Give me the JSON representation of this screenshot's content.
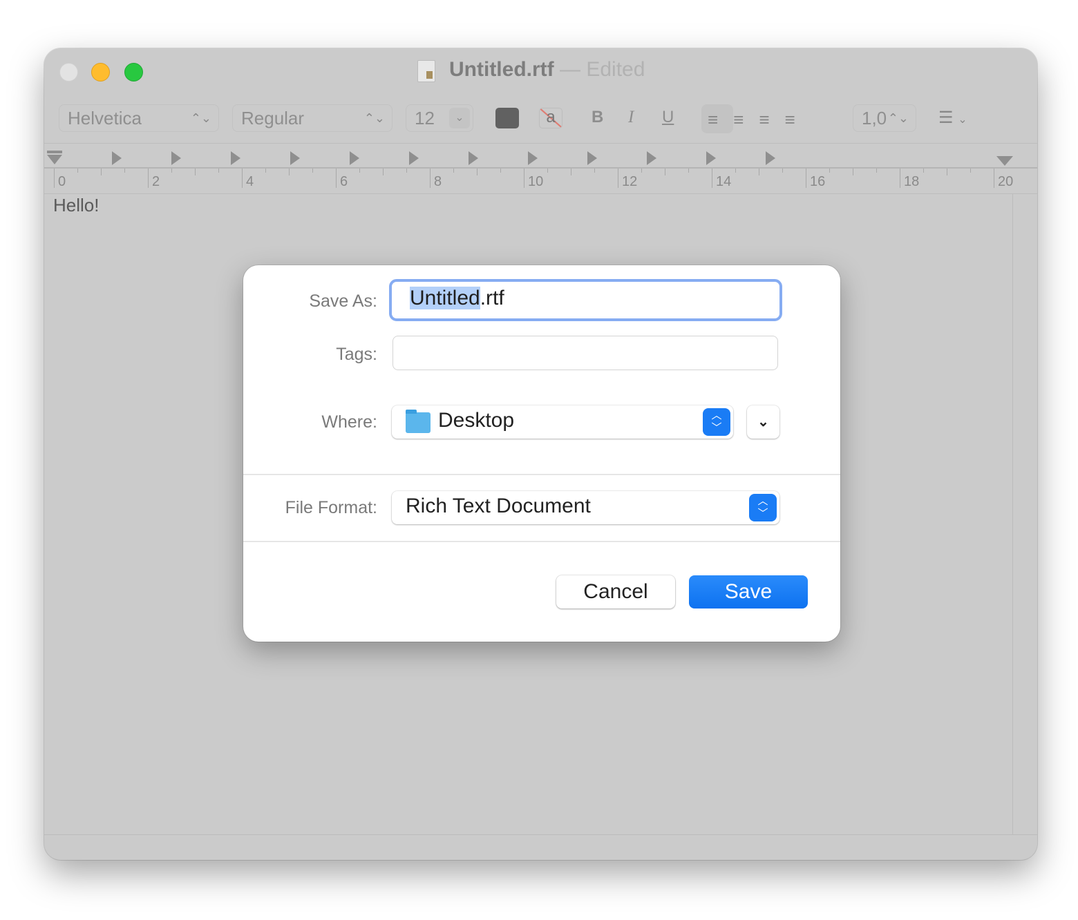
{
  "window": {
    "title": "Untitled.rtf",
    "title_separator": "—",
    "status": "Edited",
    "icon": "rtf-document-icon",
    "traffic_lights": {
      "close": "#e3e3e3",
      "minimize": "#febc2e",
      "zoom": "#28c840"
    }
  },
  "toolbar": {
    "font_family": "Helvetica",
    "font_style": "Regular",
    "font_size": "12",
    "text_color": "#616161",
    "highlight_icon_label": "a",
    "bold": "B",
    "italic": "I",
    "underline": "U",
    "line_spacing": "1,0",
    "alignment_selected": "left"
  },
  "ruler": {
    "labels": [
      "0",
      "2",
      "4",
      "6",
      "8",
      "10",
      "12",
      "14",
      "16",
      "18",
      "20"
    ]
  },
  "document": {
    "text": "Hello!"
  },
  "save_dialog": {
    "save_as_label": "Save As:",
    "filename_selected": "Untitled",
    "filename_rest": ".rtf",
    "tags_label": "Tags:",
    "tags_value": "",
    "where_label": "Where:",
    "where_value": "Desktop",
    "file_format_label": "File Format:",
    "file_format_value": "Rich Text Document",
    "cancel": "Cancel",
    "save": "Save",
    "accent": "#1a7cf5"
  }
}
